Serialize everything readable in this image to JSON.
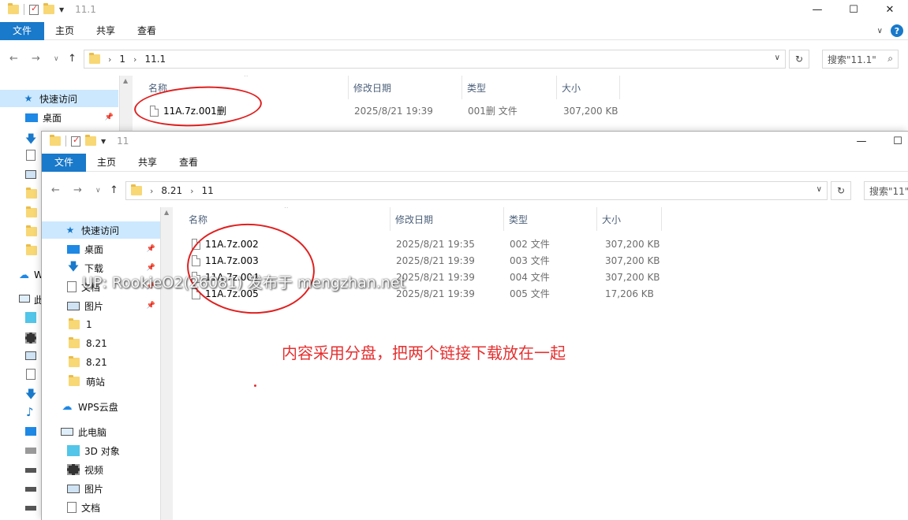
{
  "back_window": {
    "title": "11.1",
    "ribbon_tabs": [
      "文件",
      "主页",
      "共享",
      "查看"
    ],
    "controls": [
      "—",
      "☐",
      "✕"
    ],
    "breadcrumb": [
      "1",
      "11.1"
    ],
    "search_placeholder": "搜索\"11.1\"",
    "columns": [
      "名称",
      "修改日期",
      "类型",
      "大小"
    ],
    "files": [
      {
        "name": "11A.7z.001删",
        "modified": "2025/8/21 19:39",
        "type": "001删 文件",
        "size": "307,200 KB"
      }
    ],
    "nav": {
      "quick_access": "快速访问",
      "desktop": "桌面"
    }
  },
  "front_window": {
    "title": "11",
    "ribbon_tabs": [
      "文件",
      "主页",
      "共享",
      "查看"
    ],
    "controls": [
      "—",
      "☐"
    ],
    "breadcrumb": [
      "8.21",
      "11"
    ],
    "search_placeholder": "搜索\"11\"",
    "columns": [
      "名称",
      "修改日期",
      "类型",
      "大小"
    ],
    "files": [
      {
        "name": "11A.7z.002",
        "modified": "2025/8/21 19:35",
        "type": "002 文件",
        "size": "307,200 KB"
      },
      {
        "name": "11A.7z.003",
        "modified": "2025/8/21 19:39",
        "type": "003 文件",
        "size": "307,200 KB"
      },
      {
        "name": "11A.7z.004",
        "modified": "2025/8/21 19:39",
        "type": "004 文件",
        "size": "307,200 KB"
      },
      {
        "name": "11A.7z.005",
        "modified": "2025/8/21 19:39",
        "type": "005 文件",
        "size": "17,206 KB"
      }
    ],
    "nav": {
      "quick_access": "快速访问",
      "desktop": "桌面",
      "downloads": "下载",
      "documents": "文档",
      "pictures": "图片",
      "folder_1": "1",
      "folder_821a": "8.21",
      "folder_821b": "8.21",
      "folder_mengzhan": "萌站",
      "wps_cloud": "WPS云盘",
      "this_pc": "此电脑",
      "objects_3d": "3D 对象",
      "videos": "视频",
      "pictures2": "图片",
      "documents2": "文档"
    }
  },
  "annotation_text": "内容采用分盘，把两个链接下载放在一起",
  "watermark": "UP: RookieO2(26081) 发布于 mengzhan.net",
  "colors": {
    "annotation": "#e02020",
    "accent": "#1979ca",
    "selected": "#cce8ff"
  }
}
